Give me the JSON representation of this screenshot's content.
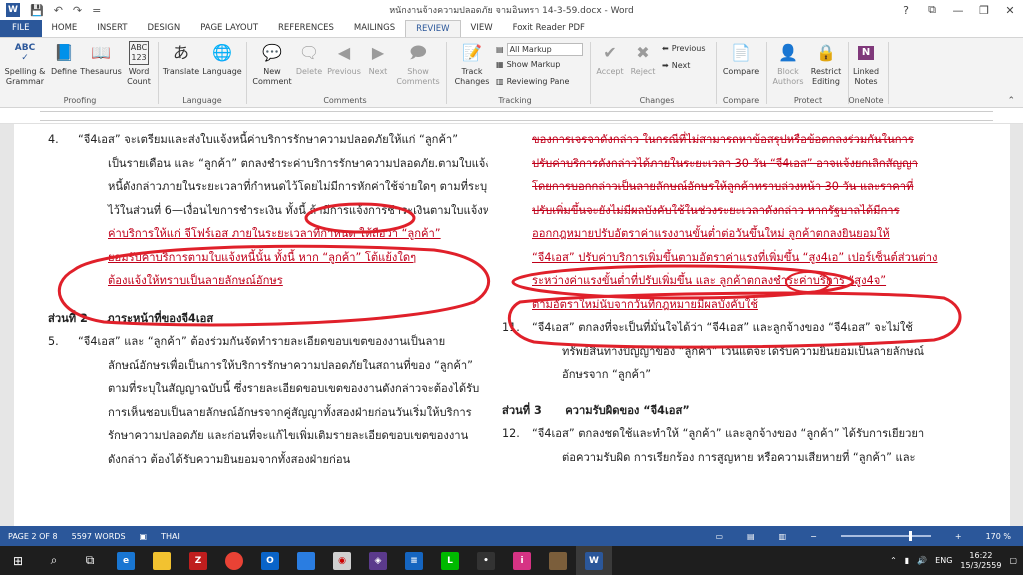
{
  "window": {
    "title": "หนักงานจ้างความปลอดภัย จามอินทรา 14-3-59.docx - Word",
    "help": "?",
    "minimize": "—",
    "restore": "❐",
    "close": "✕"
  },
  "quick_access": {
    "word_icon": "W",
    "save": "💾",
    "undo": "↶",
    "redo": "↷",
    "customize": "="
  },
  "tabs": [
    "FILE",
    "HOME",
    "INSERT",
    "DESIGN",
    "PAGE LAYOUT",
    "REFERENCES",
    "MAILINGS",
    "REVIEW",
    "VIEW",
    "Foxit Reader PDF"
  ],
  "active_tab": "REVIEW",
  "ribbon": {
    "spelling": "Spelling &\nGrammar",
    "define": "Define",
    "thesaurus": "Thesaurus",
    "word_count": "Word\nCount",
    "translate": "Translate",
    "language": "Language",
    "new_comment": "New\nComment",
    "delete": "Delete",
    "previous": "Previous",
    "next": "Next",
    "show_comments": "Show\nComments",
    "track_changes": "Track\nChanges",
    "all_markup": "All Markup",
    "show_markup": "Show Markup",
    "reviewing_pane": "Reviewing Pane",
    "accept": "Accept",
    "reject": "Reject",
    "prev_change": "Previous",
    "next_change": "Next",
    "compare": "Compare",
    "block_authors": "Block\nAuthors",
    "restrict_editing": "Restrict\nEditing",
    "linked_notes": "Linked\nNotes",
    "groups": {
      "proofing": "Proofing",
      "language": "Language",
      "comments": "Comments",
      "tracking": "Tracking",
      "changes": "Changes",
      "compare": "Compare",
      "protect": "Protect",
      "onenote": "OneNote"
    }
  },
  "document": {
    "left": [
      {
        "n": "4.",
        "t": "“จี4เอส” จะเตรียมและส่งใบแจ้งหนี้ค่าบริการรักษาความปลอดภัยให้แก่ “ลูกค้า”"
      },
      {
        "n": "",
        "t": "เป็นรายเดือน และ “ลูกค้า” ตกลงชำระค่าบริการรักษาความปลอดภัย.ตามใบแจ้ง"
      },
      {
        "n": "",
        "t": "หนี้ดังกล่าวภายในระยะเวลาที่กำหนดไว้โดยไม่มีการหักค่าใช้จ่ายใดๆ ตามที่ระบุ"
      },
      {
        "n": "",
        "t": "ไว้ในส่วนที่ 6—เงื่อนไขการชำระเงิน ทั้งนี้ ถ้ามีการแจ้งการชำระเงินตามใบแจ้งหนี้"
      },
      {
        "n": "",
        "t": "ค่าบริการให้แก่ จีโฟร์เอส ภายในระยะเวลาที่กำหนด ให้ถือว่า “ลูกค้า”",
        "red": true
      },
      {
        "n": "",
        "t": "ยอมรับค่าบริการตามใบแจ้งหนี้นั้น ทั้งนี้ หาก “ลูกค้า” โต้แย้งใดๆ",
        "red": true
      },
      {
        "n": "",
        "t": "ต้องแจ้งให้ทราบเป็นลายลักษณ์อักษร",
        "red": true
      }
    ],
    "left_heading": {
      "part": "ส่วนที่ 2",
      "title": "ภาระหน้าที่ของจี4เอส"
    },
    "left2": [
      {
        "n": "5.",
        "t": "“จี4เอส” และ “ลูกค้า” ต้องร่วมกันจัดทำรายละเอียดขอบเขตของงานเป็นลาย"
      },
      {
        "n": "",
        "t": "ลักษณ์อักษรเพื่อเป็นการให้บริการรักษาความปลอดภัยในสถานที่ของ “ลูกค้า”"
      },
      {
        "n": "",
        "t": "ตามที่ระบุในสัญญาฉบับนี้ ซึ่งรายละเอียดขอบเขตของงานดังกล่าวจะต้องได้รับ"
      },
      {
        "n": "",
        "t": "การเห็นชอบเป็นลายลักษณ์อักษรจากคู่สัญญาทั้งสองฝ่ายก่อนวันเริ่มให้บริการ"
      },
      {
        "n": "",
        "t": "รักษาความปลอดภัย และก่อนที่จะแก้ไขเพิ่มเติมรายละเอียดขอบเขตของงาน"
      },
      {
        "n": "",
        "t": "ดังกล่าว ต้องได้รับความยินยอมจากทั้งสองฝ่ายก่อน"
      }
    ],
    "right": [
      {
        "t": "ของการเจรจาดังกล่าว ในกรณีที่ไม่สามารถหาข้อสรุปหรือข้อตกลงร่วมกันในการ",
        "strike": true
      },
      {
        "t": "ปรับค่าบริการดังกล่าวได้ภายในระยะเวลา 30 วัน “จี4เอส” อาจแจ้งยกเลิกสัญญา",
        "strike": true
      },
      {
        "t": "โดยการบอกกล่าวเป็นลายลักษณ์อักษรให้ลูกค้าทราบล่วงหน้า 30 วัน และราคาที่",
        "strike": true
      },
      {
        "t": "ปรับเพิ่มขึ้นจะยังไม่มีผลบังคับใช้ในช่วงระยะเวลาดังกล่าว หากรัฐบาลได้มีการ",
        "mixed": true
      },
      {
        "t": "ออกกฎหมายปรับอัตราค่าแรงงานขั้นต่ำต่อวันขึ้นใหม่ ลูกค้าตกลงยินยอมให้",
        "red": true
      },
      {
        "t": "“จี4เอส” ปรับค่าบริการเพิ่มขึ้นตามอัตราค่าแรงที่เพิ่มขึ้น “สูง4เอ” เปอร์เซ็นต์ส่วนต่าง",
        "red": true
      },
      {
        "t": "ระหว่างค่าแรงขั้นต่ำที่ปรับเพิ่มขึ้น และ ลูกค้าตกลงชำระค่าบริการ “สูง4จ”",
        "red": true
      },
      {
        "t": "ตามอัตราใหม่นับจากวันที่กฎหมายมีผลบังคับใช้",
        "red": true
      }
    ],
    "right2": [
      {
        "n": "11.",
        "t": "“จี4เอส” ตกลงที่จะเป็นที่มั่นใจได้ว่า “จี4เอส” และลูกจ้างของ “จี4เอส” จะไม่ใช้"
      },
      {
        "n": "",
        "t": "ทรัพย์สินทางปัญญาของ “ลูกค้า” เว้นแต่จะได้รับความยินยอมเป็นลายลักษณ์"
      },
      {
        "n": "",
        "t": "อักษรจาก “ลูกค้า”"
      }
    ],
    "right_heading": {
      "part": "ส่วนที่ 3",
      "title": "ความรับผิดของ “จี4เอส”"
    },
    "right3": [
      {
        "n": "12.",
        "t": "“จี4เอส” ตกลงชดใช้และทำให้ “ลูกค้า” และลูกจ้างของ “ลูกค้า” ได้รับการเยียวยา"
      },
      {
        "n": "",
        "t": "ต่อความรับผิด การเรียกร้อง การสูญหาย หรือความเสียหายที่ “ลูกค้า” และ"
      }
    ]
  },
  "status": {
    "page": "PAGE 2 OF 8",
    "words": "5597 WORDS",
    "lang": "THAI",
    "zoom": "170 %"
  },
  "taskbar": {
    "lang": "ENG",
    "time": "16:22",
    "date": "15/3/2559"
  }
}
